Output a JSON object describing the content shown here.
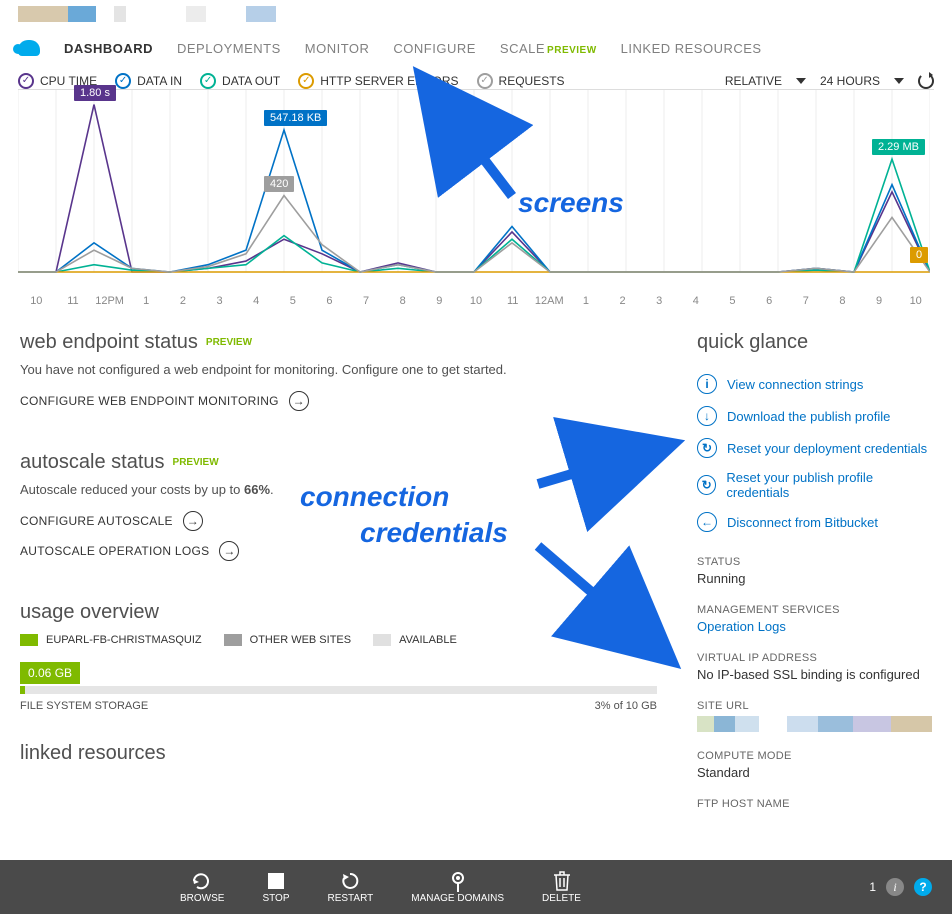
{
  "tabs": {
    "items": [
      {
        "label": "DASHBOARD",
        "active": true
      },
      {
        "label": "DEPLOYMENTS"
      },
      {
        "label": "MONITOR"
      },
      {
        "label": "CONFIGURE"
      },
      {
        "label": "SCALE",
        "preview": "PREVIEW"
      },
      {
        "label": "LINKED RESOURCES"
      }
    ]
  },
  "metrics": {
    "items": [
      {
        "label": "CPU TIME",
        "color": "#59358c"
      },
      {
        "label": "DATA IN",
        "color": "#0072c6"
      },
      {
        "label": "DATA OUT",
        "color": "#00b294"
      },
      {
        "label": "HTTP SERVER ERRORS",
        "color": "#dc9b00"
      },
      {
        "label": "REQUESTS",
        "color": "#9e9e9e"
      }
    ],
    "relative": "RELATIVE",
    "range": "24 HOURS"
  },
  "chart_data": {
    "type": "line",
    "x_ticks": [
      "10",
      "11",
      "12PM",
      "1",
      "2",
      "3",
      "4",
      "5",
      "6",
      "7",
      "8",
      "9",
      "10",
      "11",
      "12AM",
      "1",
      "2",
      "3",
      "4",
      "5",
      "6",
      "7",
      "8",
      "9",
      "10"
    ],
    "labels": [
      {
        "series": "CPU TIME",
        "text": "1.80 s",
        "color": "#59358c",
        "x": 2,
        "y": 0.92
      },
      {
        "series": "DATA IN",
        "text": "547.18 KB",
        "color": "#0072c6",
        "x": 7,
        "y": 0.78
      },
      {
        "series": "REQUESTS",
        "text": "420",
        "color": "#9e9e9e",
        "x": 7,
        "y": 0.42
      },
      {
        "series": "DATA OUT",
        "text": "2.29 MB",
        "color": "#00b294",
        "x": 23,
        "y": 0.62
      },
      {
        "series": "HTTP SERVER ERRORS",
        "text": "0",
        "color": "#dc9b00",
        "x": 24,
        "y": 0.03
      }
    ],
    "series": [
      {
        "name": "CPU TIME",
        "color": "#59358c",
        "values": [
          0,
          0,
          0.92,
          0,
          0,
          0.02,
          0.06,
          0.18,
          0.1,
          0,
          0.05,
          0,
          0,
          0.22,
          0,
          0,
          0,
          0,
          0,
          0,
          0,
          0.02,
          0,
          0.44,
          0
        ]
      },
      {
        "name": "DATA IN",
        "color": "#0072c6",
        "values": [
          0,
          0,
          0.16,
          0.02,
          0,
          0.04,
          0.12,
          0.78,
          0.12,
          0,
          0.04,
          0,
          0,
          0.25,
          0,
          0,
          0,
          0,
          0,
          0,
          0,
          0.02,
          0,
          0.48,
          0
        ]
      },
      {
        "name": "DATA OUT",
        "color": "#00b294",
        "values": [
          0,
          0,
          0.04,
          0.01,
          0,
          0.02,
          0.04,
          0.2,
          0.05,
          0,
          0.02,
          0,
          0,
          0.18,
          0,
          0,
          0,
          0,
          0,
          0,
          0,
          0.01,
          0,
          0.62,
          0
        ]
      },
      {
        "name": "HTTP SERVER ERRORS",
        "color": "#dc9b00",
        "values": [
          0,
          0,
          0,
          0,
          0,
          0,
          0,
          0,
          0,
          0,
          0,
          0,
          0,
          0,
          0,
          0,
          0,
          0,
          0,
          0,
          0,
          0,
          0,
          0,
          0
        ]
      },
      {
        "name": "REQUESTS",
        "color": "#9e9e9e",
        "values": [
          0,
          0,
          0.12,
          0.02,
          0,
          0.03,
          0.1,
          0.42,
          0.15,
          0,
          0.04,
          0,
          0,
          0.16,
          0,
          0,
          0,
          0,
          0,
          0,
          0,
          0.02,
          0,
          0.3,
          0
        ]
      }
    ]
  },
  "sections": {
    "endpoint": {
      "title": "web endpoint status",
      "preview": "PREVIEW",
      "text": "You have not configured a web endpoint for monitoring. Configure one to get started.",
      "cta": "CONFIGURE WEB ENDPOINT MONITORING"
    },
    "autoscale": {
      "title": "autoscale status",
      "preview": "PREVIEW",
      "text_prefix": "Autoscale reduced your costs by up to ",
      "text_pct": "66%",
      "text_suffix": ".",
      "configure": "CONFIGURE AUTOSCALE",
      "logs": "AUTOSCALE OPERATION LOGS"
    },
    "usage": {
      "title": "usage overview",
      "legend": [
        {
          "label": "EUPARL-FB-CHRISTMASQUIZ",
          "color": "#7fba00"
        },
        {
          "label": "OTHER WEB SITES",
          "color": "#9e9e9e"
        },
        {
          "label": "AVAILABLE",
          "color": "#e0e0e0"
        }
      ],
      "badge": "0.06 GB",
      "caption_left": "FILE SYSTEM STORAGE",
      "caption_right": "3% of 10 GB"
    },
    "linked": {
      "title": "linked resources"
    }
  },
  "quick_glance": {
    "title": "quick glance",
    "links": [
      {
        "icon": "i",
        "label": "View connection strings"
      },
      {
        "icon": "↓",
        "label": "Download the publish profile"
      },
      {
        "icon": "↻",
        "label": "Reset your deployment credentials"
      },
      {
        "icon": "↻",
        "label": "Reset your publish profile credentials"
      },
      {
        "icon": "←",
        "label": "Disconnect from Bitbucket"
      }
    ],
    "kv": [
      {
        "k": "STATUS",
        "v": "Running"
      },
      {
        "k": "MANAGEMENT SERVICES",
        "v": "Operation Logs",
        "link": true
      },
      {
        "k": "VIRTUAL IP ADDRESS",
        "v": "No IP-based SSL binding is configured"
      },
      {
        "k": "SITE URL",
        "bar": true
      },
      {
        "k": "COMPUTE MODE",
        "v": "Standard"
      },
      {
        "k": "FTP HOST NAME"
      }
    ]
  },
  "footer": {
    "actions": [
      {
        "label": "BROWSE",
        "icon": "browse"
      },
      {
        "label": "STOP",
        "icon": "stop"
      },
      {
        "label": "RESTART",
        "icon": "restart"
      },
      {
        "label": "MANAGE DOMAINS",
        "icon": "domain"
      },
      {
        "label": "DELETE",
        "icon": "trash"
      }
    ],
    "count": "1"
  },
  "annotations": {
    "screens": "screens",
    "conn": "connection",
    "cred": "credentials"
  }
}
